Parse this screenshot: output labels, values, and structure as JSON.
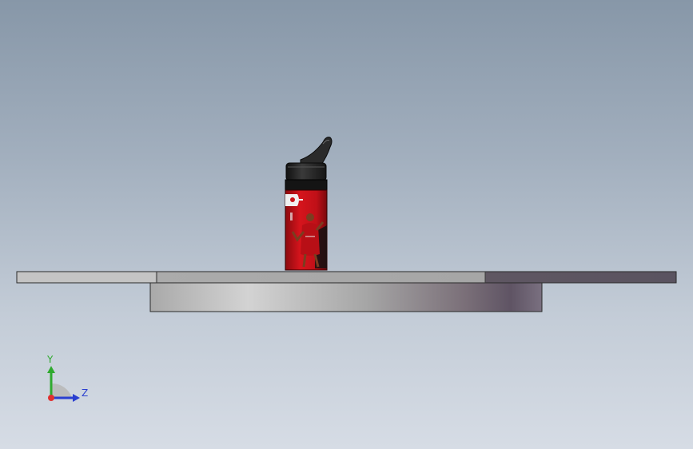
{
  "viewport": {
    "background_top": "#8797a8",
    "background_bottom": "#d6dce5"
  },
  "scene": {
    "object": "sports-bottle",
    "cap_color": "#1c1c1c",
    "body_color": "#c8141a",
    "base_plate_color": "#a9a9a9",
    "underside_color": "#b5b5b5"
  },
  "triad": {
    "y_label": "Y",
    "z_label": "Z",
    "y_color": "#2faa2f",
    "z_color": "#2a3fd0",
    "x_color": "#e03030"
  }
}
